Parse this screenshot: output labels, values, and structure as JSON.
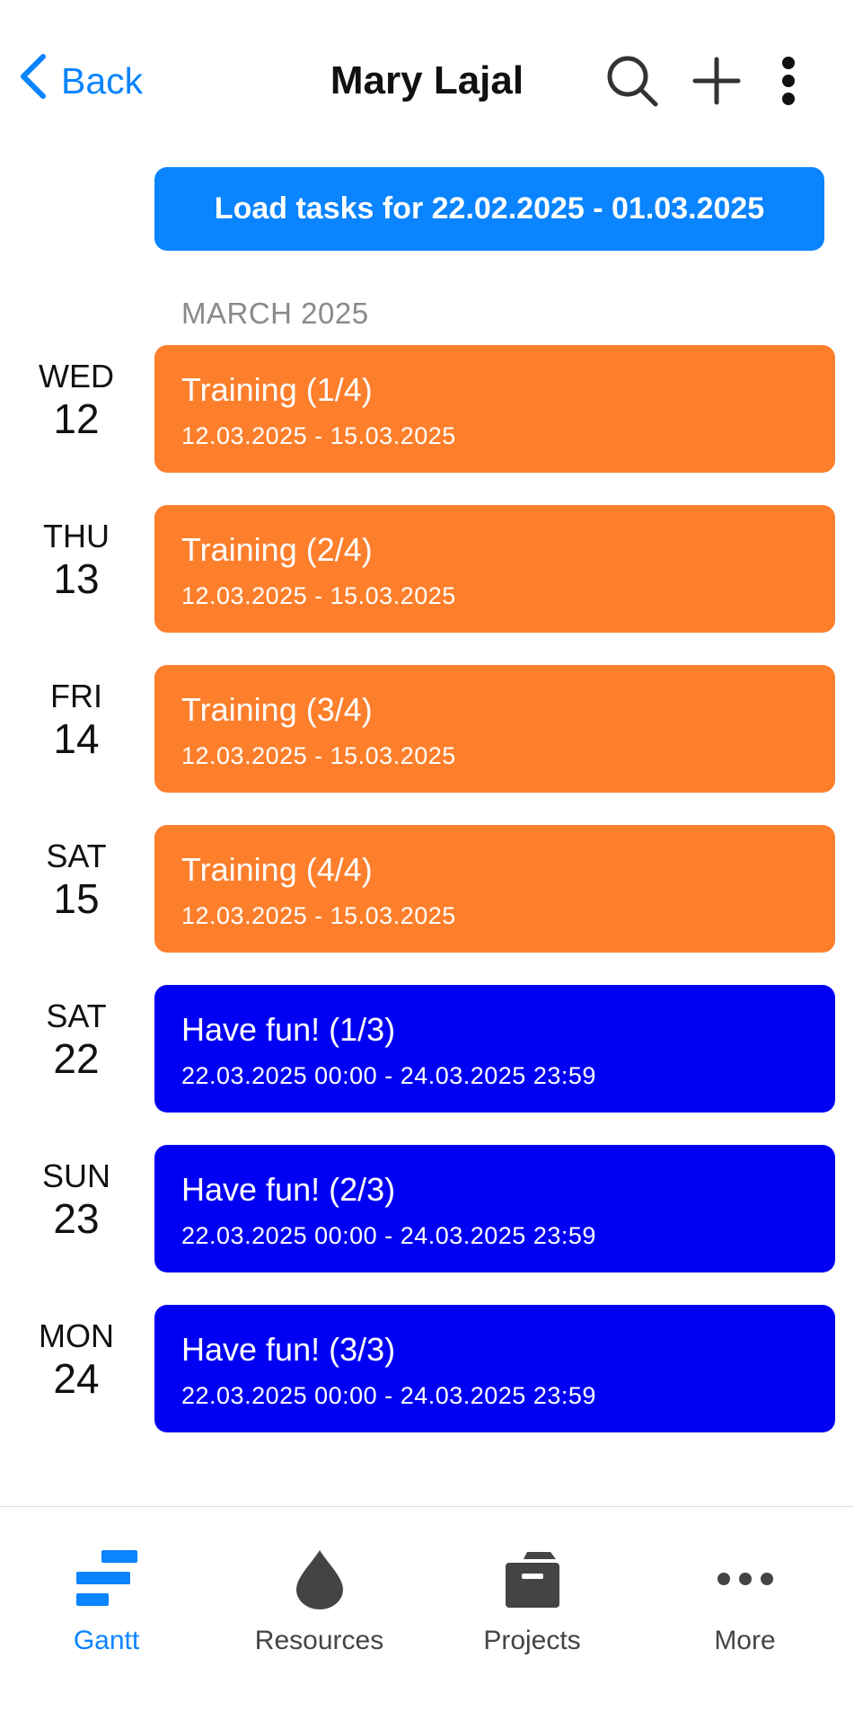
{
  "header": {
    "back_label": "Back",
    "title": "Mary Lajal"
  },
  "load_button": "Load tasks for 22.02.2025 - 01.03.2025",
  "month_label": "MARCH 2025",
  "rows": [
    {
      "dow": "WED",
      "dom": "12",
      "title": "Training (1/4)",
      "dates": "12.03.2025 - 15.03.2025",
      "color": "#fd7f2c"
    },
    {
      "dow": "THU",
      "dom": "13",
      "title": "Training (2/4)",
      "dates": "12.03.2025 - 15.03.2025",
      "color": "#fd7f2c"
    },
    {
      "dow": "FRI",
      "dom": "14",
      "title": "Training (3/4)",
      "dates": "12.03.2025 - 15.03.2025",
      "color": "#fd7f2c"
    },
    {
      "dow": "SAT",
      "dom": "15",
      "title": "Training (4/4)",
      "dates": "12.03.2025 - 15.03.2025",
      "color": "#fd7f2c"
    },
    {
      "dow": "SAT",
      "dom": "22",
      "title": "Have fun! (1/3)",
      "dates": "22.03.2025 00:00 - 24.03.2025 23:59",
      "color": "#0000f5"
    },
    {
      "dow": "SUN",
      "dom": "23",
      "title": "Have fun! (2/3)",
      "dates": "22.03.2025 00:00 - 24.03.2025 23:59",
      "color": "#0000f5"
    },
    {
      "dow": "MON",
      "dom": "24",
      "title": "Have fun! (3/3)",
      "dates": "22.03.2025 00:00 - 24.03.2025 23:59",
      "color": "#0000f5"
    }
  ],
  "tabs": [
    {
      "label": "Gantt",
      "icon": "gantt-icon"
    },
    {
      "label": "Resources",
      "icon": "drop-icon"
    },
    {
      "label": "Projects",
      "icon": "archive-box-icon"
    },
    {
      "label": "More",
      "icon": "ellipsis-icon"
    }
  ],
  "colors": {
    "accent": "#0a84ff",
    "training": "#fd7f2c",
    "fun": "#0000f5"
  }
}
